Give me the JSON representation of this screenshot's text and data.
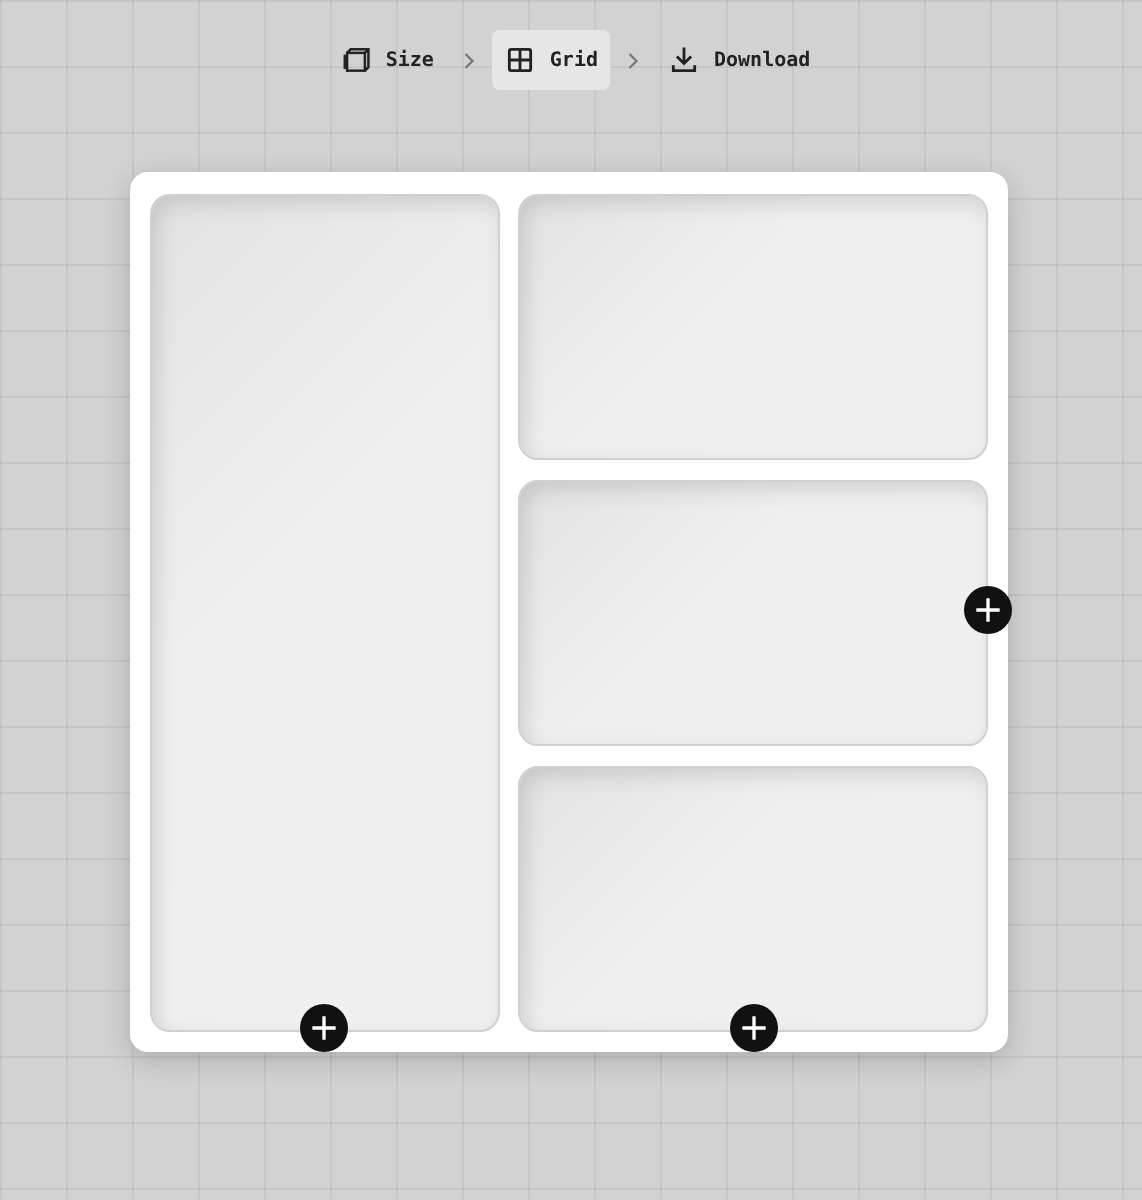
{
  "steps": [
    {
      "label": "Size",
      "selected": false
    },
    {
      "label": "Grid",
      "selected": true
    },
    {
      "label": "Download",
      "selected": false
    }
  ]
}
